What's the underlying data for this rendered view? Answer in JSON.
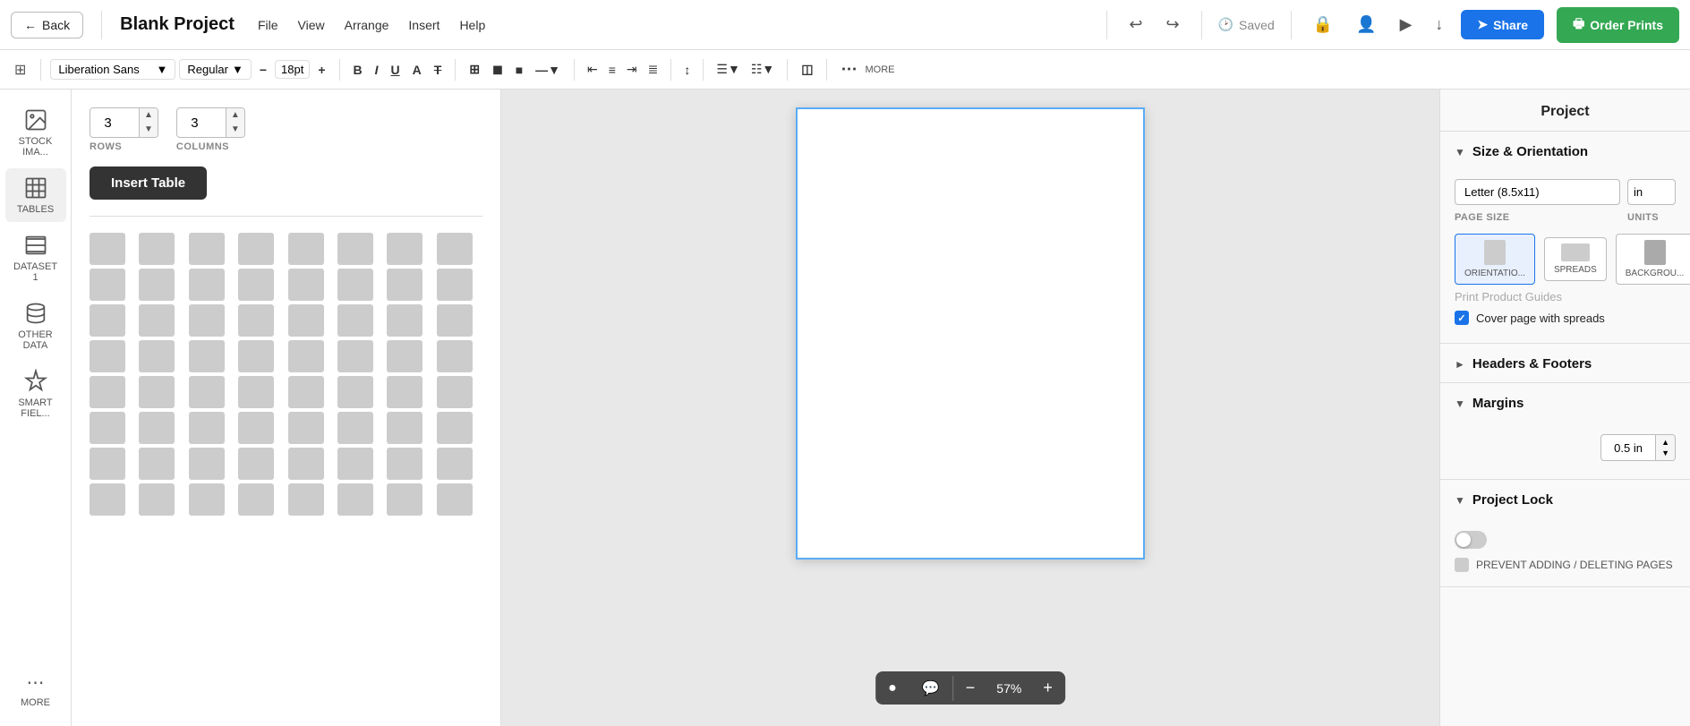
{
  "topbar": {
    "back_label": "Back",
    "project_title": "Blank Project",
    "menu_items": [
      "File",
      "View",
      "Arrange",
      "Insert",
      "Help"
    ],
    "saved_label": "Saved",
    "share_label": "Share",
    "order_label": "Order Prints"
  },
  "toolbar": {
    "font_name": "Liberation Sans",
    "font_style": "Regular",
    "font_size": "18pt",
    "more_label": "MORE"
  },
  "insert_panel": {
    "rows_label": "ROWS",
    "rows_value": "3",
    "columns_label": "COLUMNS",
    "columns_value": "3",
    "insert_table_btn": "Insert Table"
  },
  "sidebar": {
    "items": [
      {
        "id": "stock-images",
        "label": "STOCK IMA...",
        "icon": "image"
      },
      {
        "id": "tables",
        "label": "TABLES",
        "icon": "table"
      },
      {
        "id": "dataset",
        "label": "DATASET 1",
        "icon": "dataset"
      },
      {
        "id": "other-data",
        "label": "OTHER DATA",
        "icon": "database"
      },
      {
        "id": "smart-fields",
        "label": "SMART FIEL...",
        "icon": "smart"
      },
      {
        "id": "more",
        "label": "MORE",
        "icon": "more"
      }
    ]
  },
  "right_panel": {
    "title": "Project",
    "sections": [
      {
        "id": "size-orientation",
        "label": "Size & Orientation",
        "expanded": true,
        "page_size_label": "PAGE SIZE",
        "page_size_value": "Letter (8.5x11)",
        "units_label": "UNITS",
        "units_value": "in",
        "orientation_options": [
          "Portrait",
          "Spreads",
          "Background"
        ],
        "print_guides_label": "Print Product Guides",
        "cover_spread_label": "Cover page with spreads",
        "cover_spread_checked": true
      },
      {
        "id": "headers-footers",
        "label": "Headers & Footers",
        "expanded": false
      },
      {
        "id": "margins",
        "label": "Margins",
        "expanded": true,
        "value": "0.5 in"
      },
      {
        "id": "project-lock",
        "label": "Project Lock",
        "expanded": true,
        "toggle_on": false,
        "prevent_label": "PREVENT ADDING / DELETING PAGES"
      }
    ]
  },
  "zoom": {
    "level": "57%",
    "minus": "−",
    "plus": "+"
  }
}
